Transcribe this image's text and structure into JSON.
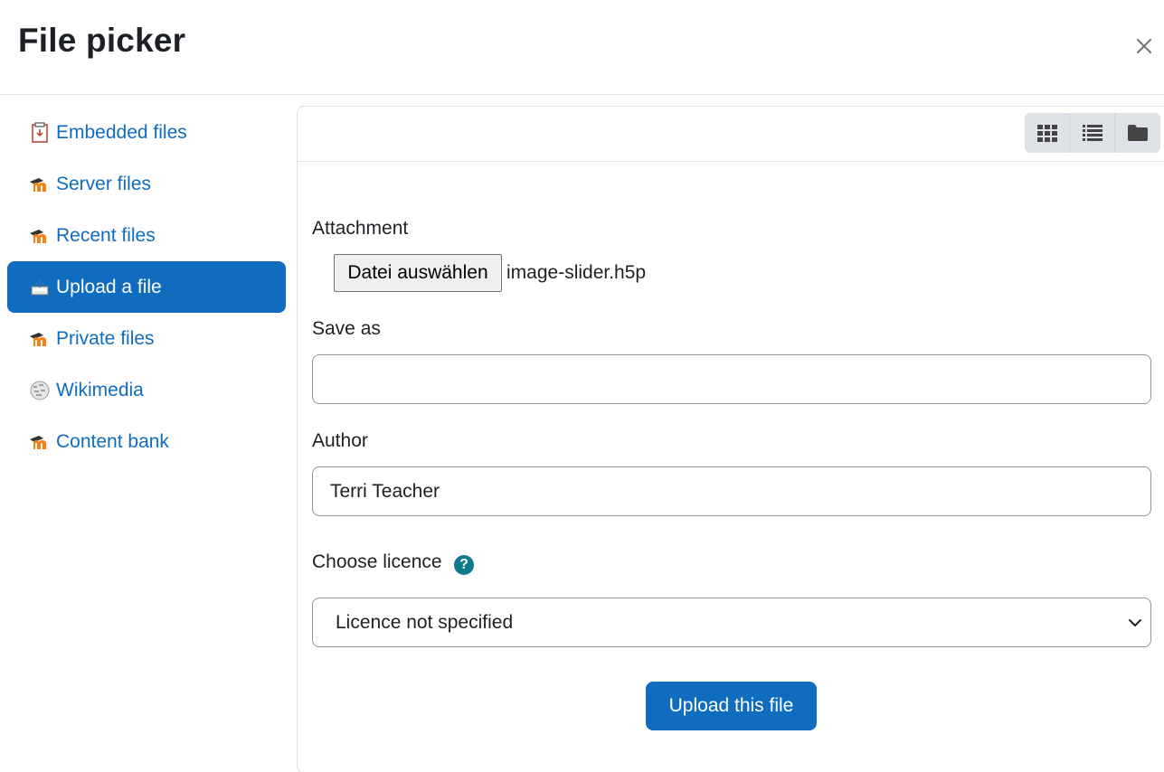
{
  "dialog": {
    "title": "File picker",
    "close_icon": "close-icon"
  },
  "sidebar": {
    "items": [
      {
        "label": "Embedded files",
        "icon": "embedded-files-icon",
        "active": false
      },
      {
        "label": "Server files",
        "icon": "moodle-icon",
        "active": false
      },
      {
        "label": "Recent files",
        "icon": "moodle-icon",
        "active": false
      },
      {
        "label": "Upload a file",
        "icon": "upload-icon",
        "active": true
      },
      {
        "label": "Private files",
        "icon": "moodle-icon",
        "active": false
      },
      {
        "label": "Wikimedia",
        "icon": "wikimedia-icon",
        "active": false
      },
      {
        "label": "Content bank",
        "icon": "moodle-icon",
        "active": false
      }
    ]
  },
  "toolbar": {
    "views": [
      "grid-view-icon",
      "list-view-icon",
      "folder-view-icon"
    ]
  },
  "form": {
    "attachment_label": "Attachment",
    "file_button": "Datei auswählen",
    "file_name": "image-slider.h5p",
    "save_as_label": "Save as",
    "save_as_value": "",
    "author_label": "Author",
    "author_value": "Terri Teacher",
    "licence_label": "Choose licence",
    "licence_value": "Licence not specified",
    "upload_button": "Upload this file"
  },
  "colors": {
    "accent": "#0f6cbf",
    "help": "#0f7a8a",
    "moodle_orange": "#f98012"
  }
}
